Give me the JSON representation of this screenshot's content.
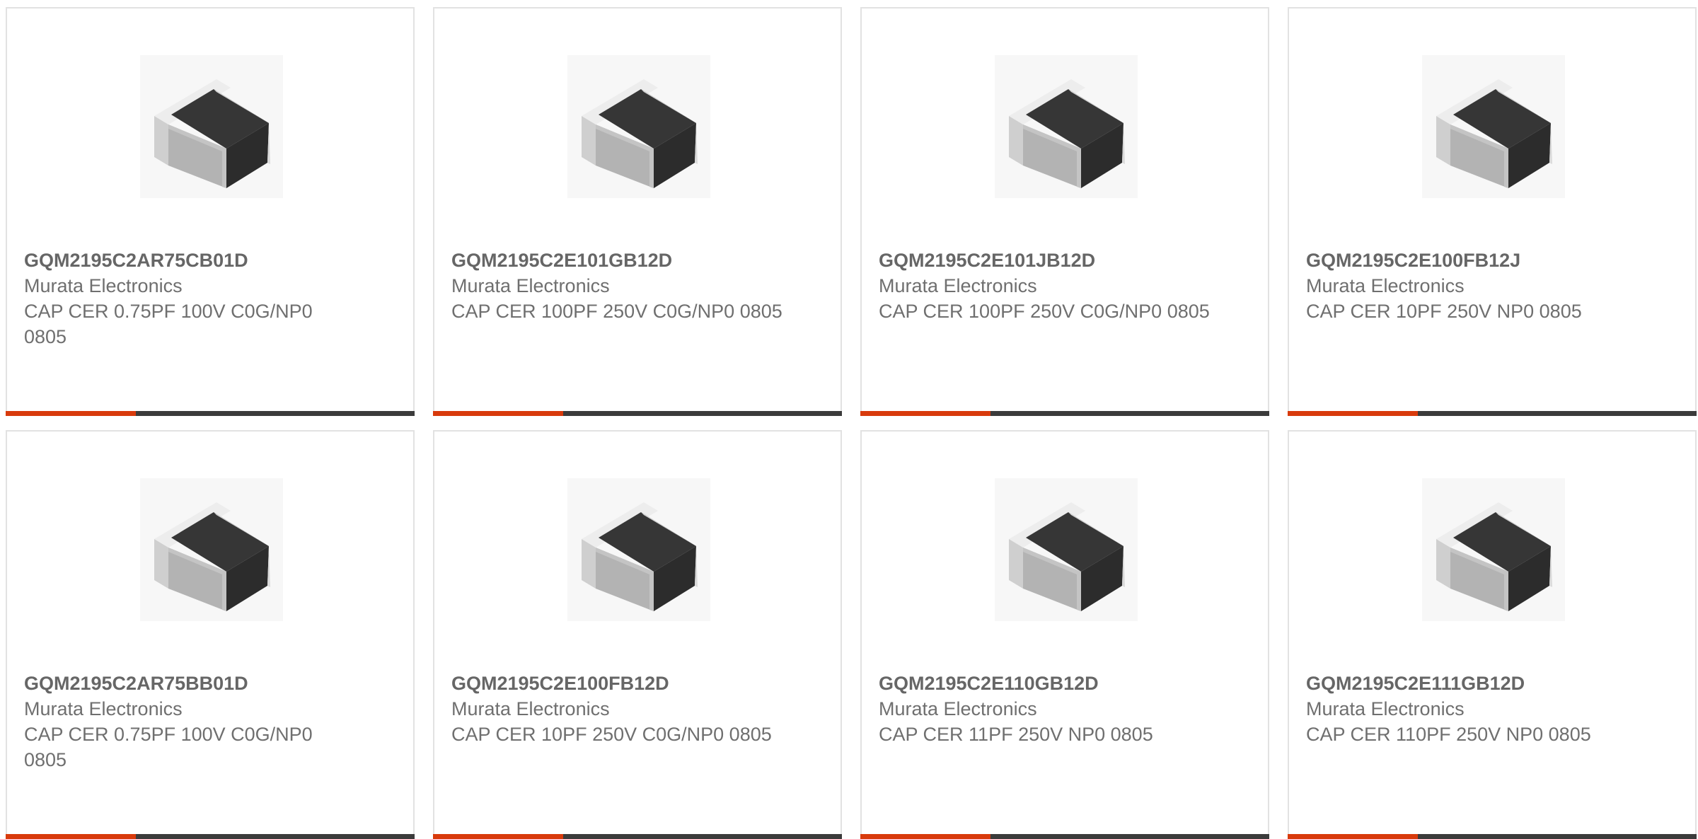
{
  "colors": {
    "accent": "#d83a0c",
    "bar_dark": "#3b3b3b",
    "text": "#6f6f6f"
  },
  "products": [
    {
      "part": "GQM2195C2AR75CB01D",
      "manufacturer": "Murata Electronics",
      "description": "CAP CER 0.75PF 100V C0G/NP0 0805",
      "image": "capacitor-chip-icon"
    },
    {
      "part": "GQM2195C2E101GB12D",
      "manufacturer": "Murata Electronics",
      "description": "CAP CER 100PF 250V C0G/NP0 0805",
      "image": "capacitor-chip-icon"
    },
    {
      "part": "GQM2195C2E101JB12D",
      "manufacturer": "Murata Electronics",
      "description": "CAP CER 100PF 250V C0G/NP0 0805",
      "image": "capacitor-chip-icon"
    },
    {
      "part": "GQM2195C2E100FB12J",
      "manufacturer": "Murata Electronics",
      "description": "CAP CER 10PF 250V NP0 0805",
      "image": "capacitor-chip-icon"
    },
    {
      "part": "GQM2195C2AR75BB01D",
      "manufacturer": "Murata Electronics",
      "description": "CAP CER 0.75PF 100V C0G/NP0 0805",
      "image": "capacitor-chip-icon"
    },
    {
      "part": "GQM2195C2E100FB12D",
      "manufacturer": "Murata Electronics",
      "description": "CAP CER 10PF 250V C0G/NP0 0805",
      "image": "capacitor-chip-icon"
    },
    {
      "part": "GQM2195C2E110GB12D",
      "manufacturer": "Murata Electronics",
      "description": "CAP CER 11PF 250V NP0 0805",
      "image": "capacitor-chip-icon"
    },
    {
      "part": "GQM2195C2E111GB12D",
      "manufacturer": "Murata Electronics",
      "description": "CAP CER 110PF 250V NP0 0805",
      "image": "capacitor-chip-icon"
    }
  ]
}
